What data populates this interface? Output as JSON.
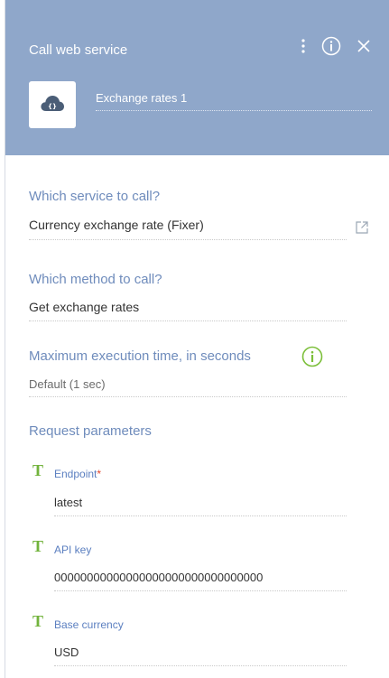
{
  "header": {
    "title": "Call web service",
    "element_name": "Exchange rates 1",
    "bg_color": "#8fa7ca"
  },
  "service": {
    "label": "Which service to call?",
    "value": "Currency exchange rate (Fixer)"
  },
  "method": {
    "label": "Which method to call?",
    "value": "Get exchange rates"
  },
  "timeout": {
    "label": "Maximum execution time, in seconds",
    "value": "Default (1 sec)"
  },
  "request_params": {
    "label": "Request parameters",
    "items": [
      {
        "type_icon": "T",
        "name": "Endpoint",
        "required": "*",
        "value": "latest"
      },
      {
        "type_icon": "T",
        "name": "API key",
        "required": "",
        "value": "00000000000000000000000000000000"
      },
      {
        "type_icon": "T",
        "name": "Base currency",
        "required": "",
        "value": "USD"
      }
    ]
  },
  "colors": {
    "accent_label": "#6f8cbc",
    "param_name": "#5b7fc0",
    "text_type_icon": "#72b33c",
    "info_icon": "#7cbf3a"
  }
}
